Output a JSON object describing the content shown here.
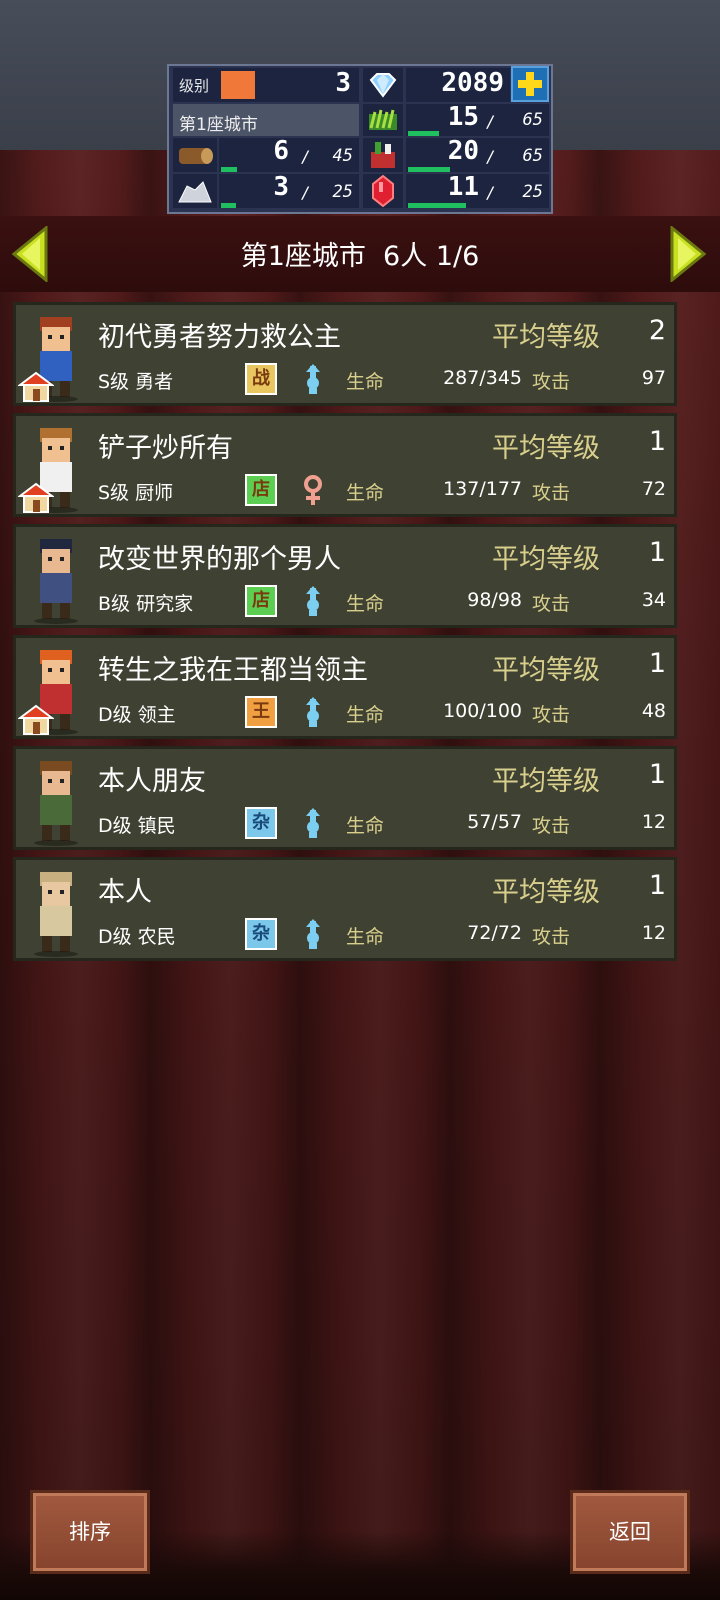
{
  "hud": {
    "level_label": "级别",
    "level": "3",
    "gems": "2089",
    "city_name": "第1座城市",
    "resources": [
      {
        "icon": "grass-icon",
        "value": "15",
        "max": "65",
        "fill": 0.23
      },
      {
        "icon": "wood-log-icon",
        "value": "6",
        "max": "45",
        "fill": 0.13
      },
      {
        "icon": "food-icon",
        "value": "20",
        "max": "65",
        "fill": 0.31
      },
      {
        "icon": "ore-icon",
        "value": "3",
        "max": "25",
        "fill": 0.12
      },
      {
        "icon": "red-gem-icon",
        "value": "11",
        "max": "25",
        "fill": 0.44
      }
    ],
    "slash": "/"
  },
  "nav": {
    "title": "第1座城市  6人 1/6"
  },
  "labels": {
    "avg_level": "平均等级",
    "life": "生命",
    "attack": "攻击"
  },
  "characters": [
    {
      "name": "初代勇者努力救公主",
      "avg_level": "2",
      "rank": "S级 勇者",
      "job": "战",
      "job_color": "#e8c760",
      "gender": "male",
      "hp": "287/345",
      "atk": "97",
      "house": true
    },
    {
      "name": "铲子炒所有",
      "avg_level": "1",
      "rank": "S级 厨师",
      "job": "店",
      "job_color": "#5ccf52",
      "gender": "female",
      "hp": "137/177",
      "atk": "72",
      "house": true
    },
    {
      "name": "改变世界的那个男人",
      "avg_level": "1",
      "rank": "B级 研究家",
      "job": "店",
      "job_color": "#5ccf52",
      "gender": "male",
      "hp": "98/98",
      "atk": "34",
      "house": false
    },
    {
      "name": "转生之我在王都当领主",
      "avg_level": "1",
      "rank": "D级 领主",
      "job": "王",
      "job_color": "#f0a040",
      "gender": "male",
      "hp": "100/100",
      "atk": "48",
      "house": true
    },
    {
      "name": "本人朋友",
      "avg_level": "1",
      "rank": "D级 镇民",
      "job": "杂",
      "job_color": "#7cc8ea",
      "gender": "male",
      "hp": "57/57",
      "atk": "12",
      "house": false
    },
    {
      "name": "本人",
      "avg_level": "1",
      "rank": "D级 农民",
      "job": "杂",
      "job_color": "#7cc8ea",
      "gender": "male",
      "hp": "72/72",
      "atk": "12",
      "house": false
    }
  ],
  "buttons": {
    "sort": "排序",
    "back": "返回"
  },
  "colors": {
    "accent_gold": "#d9cf8c",
    "bar_green": "#20c060",
    "arrow_yellow": "#c8e020"
  }
}
